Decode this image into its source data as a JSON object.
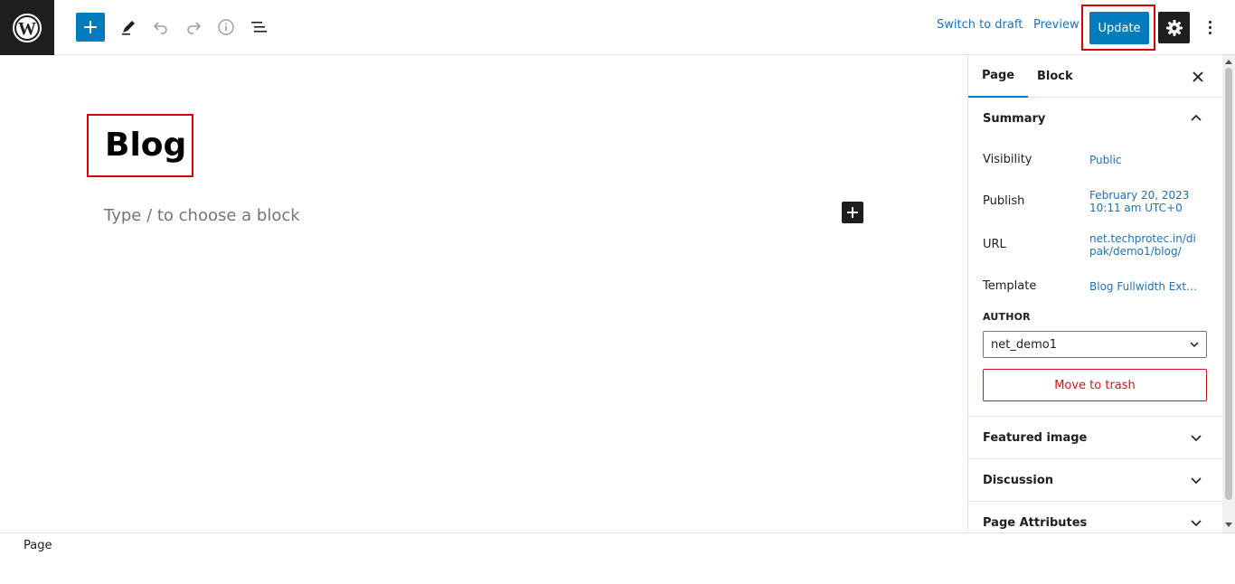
{
  "toolbar": {
    "logo_icon": "wordpress-icon",
    "add_icon": "plus-icon",
    "edit_icon": "pencil-icon",
    "undo_icon": "undo-icon",
    "redo_icon": "redo-icon",
    "info_icon": "info-icon",
    "list_view_icon": "list-view-icon",
    "switch_to_draft": "Switch to draft",
    "preview": "Preview",
    "update": "Update",
    "settings_icon": "gear-icon",
    "more_icon": "vertical-ellipsis-icon"
  },
  "editor": {
    "title": "Blog",
    "placeholder": "Type / to choose a block"
  },
  "sidebar": {
    "tabs": [
      {
        "label": "Page",
        "active": true
      },
      {
        "label": "Block",
        "active": false
      }
    ],
    "summary": {
      "heading": "Summary",
      "rows": [
        {
          "label": "Visibility",
          "value": "Public"
        },
        {
          "label": "Publish",
          "value_line1": "February 20, 2023",
          "value_line2": "10:11 am UTC+0"
        },
        {
          "label": "URL",
          "value_line1": "net.techprotec.in/di",
          "value_line2": "pak/demo1/blog/"
        },
        {
          "label": "Template",
          "value": "Blog Fullwidth Ext…"
        }
      ],
      "author_label": "AUTHOR",
      "author_value": "net_demo1",
      "trash": "Move to trash"
    },
    "panels": [
      "Featured image",
      "Discussion",
      "Page Attributes"
    ]
  },
  "footer": {
    "breadcrumb": "Page"
  },
  "colors": {
    "accent": "#007cba",
    "link": "#2271b1",
    "danger": "#cc1818",
    "highlight_box": "#d60000"
  }
}
